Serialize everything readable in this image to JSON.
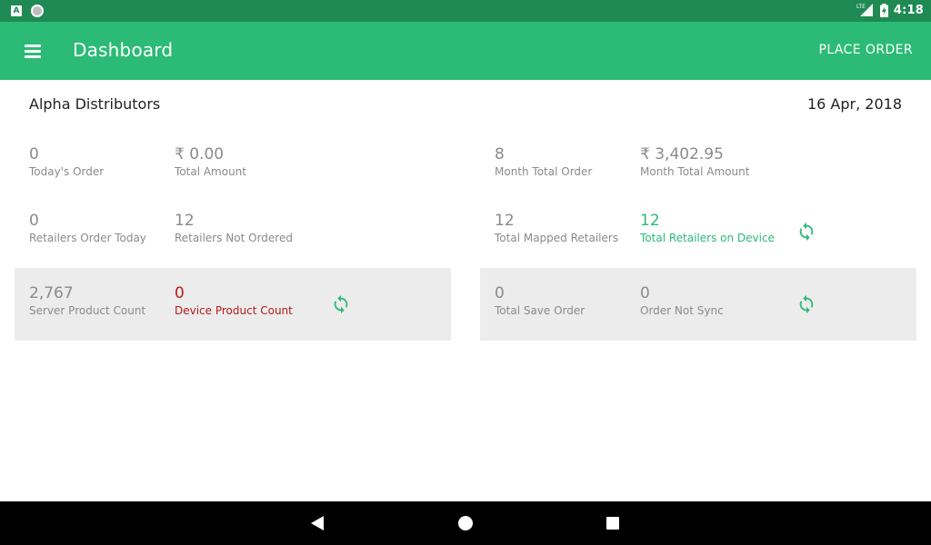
{
  "status_bar": {
    "left_icons": [
      "a-notification-icon",
      "circle-notification-icon"
    ],
    "a_glyph": "A",
    "network": "LTE",
    "time": "4:18"
  },
  "app_bar": {
    "title": "Dashboard",
    "action_label": "PLACE ORDER"
  },
  "header": {
    "company": "Alpha Distributors",
    "date": "16 Apr, 2018"
  },
  "stats": {
    "todays_order": {
      "value": "0",
      "label": "Today's Order"
    },
    "total_amount": {
      "value": "₹ 0.00",
      "label": "Total Amount"
    },
    "month_total_order": {
      "value": "8",
      "label": "Month Total Order"
    },
    "month_total_amount": {
      "value": "₹ 3,402.95",
      "label": "Month Total Amount"
    },
    "retailers_order_today": {
      "value": "0",
      "label": "Retailers Order Today"
    },
    "retailers_not_ordered": {
      "value": "12",
      "label": "Retailers Not Ordered"
    },
    "total_mapped_retailers": {
      "value": "12",
      "label": "Total Mapped Retailers"
    },
    "total_retailers_on_device": {
      "value": "12",
      "label": "Total Retailers on Device"
    },
    "server_product_count": {
      "value": "2,767",
      "label": "Server Product Count"
    },
    "device_product_count": {
      "value": "0",
      "label": "Device Product Count"
    },
    "total_save_order": {
      "value": "0",
      "label": "Total Save Order"
    },
    "order_not_sync": {
      "value": "0",
      "label": "Order Not Sync"
    }
  },
  "colors": {
    "status_bar": "#1f8a54",
    "app_bar": "#2bbb76",
    "accent_green": "#2bbb76",
    "alert_red": "#b71c1c",
    "panel_bg": "#ececec",
    "muted_text": "#8a8a8a"
  },
  "icons": {
    "menu": "hamburger-menu-icon",
    "sync": "sync-icon",
    "nav": [
      "back-icon",
      "home-icon",
      "recent-apps-icon"
    ]
  }
}
